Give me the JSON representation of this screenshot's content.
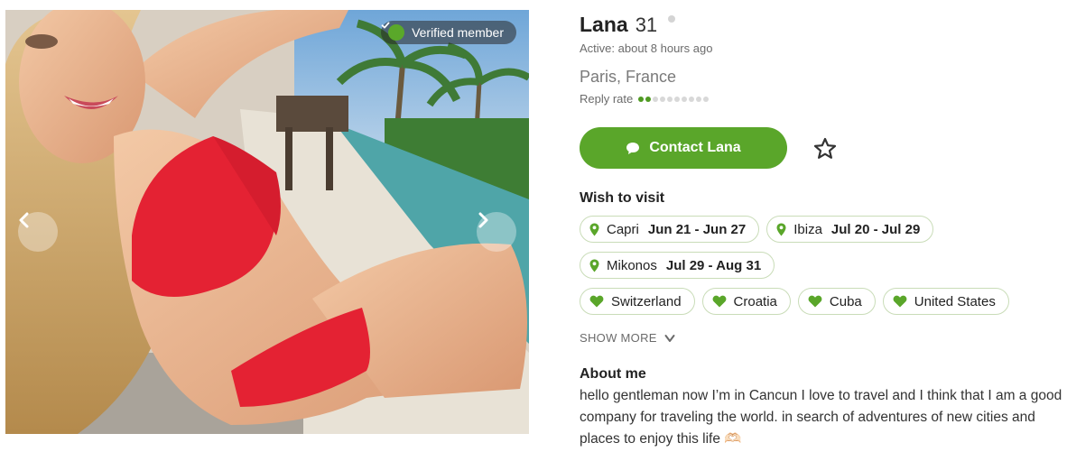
{
  "photo": {
    "verified_label": "Verified member"
  },
  "profile": {
    "name": "Lana",
    "age": "31",
    "active": "Active: about 8 hours ago",
    "location": "Paris, France",
    "reply_label": "Reply rate",
    "reply_rate": {
      "filled": 2,
      "total": 10
    }
  },
  "actions": {
    "contact_label": "Contact Lana"
  },
  "wish": {
    "title": "Wish to visit",
    "trips": [
      {
        "place": "Capri",
        "dates": "Jun 21 - Jun 27"
      },
      {
        "place": "Ibiza",
        "dates": "Jul 20 - Jul 29"
      },
      {
        "place": "Mikonos",
        "dates": "Jul 29 - Aug 31"
      }
    ],
    "countries": [
      "Switzerland",
      "Croatia",
      "Cuba",
      "United States"
    ],
    "show_more": "SHOW MORE"
  },
  "about": {
    "title": "About me",
    "text": "hello gentleman now I’m in Cancun I love to travel and I think that I am a good company for traveling the world. in search of adventures of new cities and places to enjoy this life 🫶🏻"
  },
  "colors": {
    "accent": "#5aa62a",
    "chip_border": "#c9dcb8",
    "muted_text": "#6b6b6b"
  },
  "icons": [
    "check-icon",
    "chevron-left-icon",
    "chevron-right-icon",
    "chat-bubble-icon",
    "star-outline-icon",
    "location-pin-icon",
    "heart-icon",
    "chevron-down-icon"
  ]
}
